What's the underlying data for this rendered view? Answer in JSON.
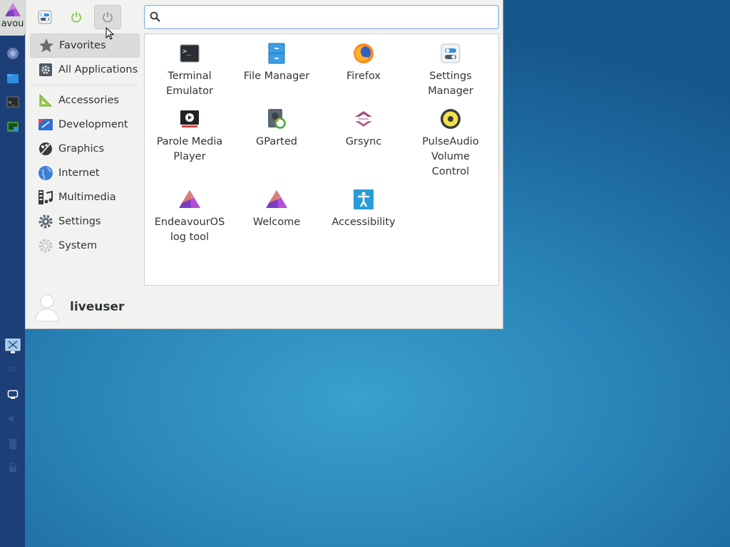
{
  "panel": {
    "menu_label": "avou",
    "launchers": [
      "web-browser-icon",
      "file-manager-icon",
      "terminal-icon",
      "screenshot-icon"
    ],
    "tray": [
      "display-icon",
      "network-icon",
      "monitor-icon",
      "volume-icon",
      "trash-icon",
      "lock-icon"
    ]
  },
  "toolbar": {
    "buttons": [
      "settings-manager-icon",
      "power-green-icon",
      "logout-icon"
    ]
  },
  "search": {
    "value": "",
    "placeholder": ""
  },
  "categories": [
    {
      "label": "Favorites",
      "icon": "star-icon",
      "selected": true
    },
    {
      "label": "All Applications",
      "icon": "gear-box-icon"
    },
    {
      "label": "Accessories",
      "icon": "set-square-icon"
    },
    {
      "label": "Development",
      "icon": "development-icon"
    },
    {
      "label": "Graphics",
      "icon": "palette-icon"
    },
    {
      "label": "Internet",
      "icon": "globe-icon"
    },
    {
      "label": "Multimedia",
      "icon": "film-music-icon"
    },
    {
      "label": "Settings",
      "icon": "gear-icon"
    },
    {
      "label": "System",
      "icon": "system-gear-icon"
    }
  ],
  "apps": [
    {
      "label": "Terminal\nEmulator",
      "icon": "terminal-icon"
    },
    {
      "label": "File Manager",
      "icon": "file-manager-icon"
    },
    {
      "label": "Firefox",
      "icon": "firefox-icon"
    },
    {
      "label": "Settings\nManager",
      "icon": "settings-manager-icon"
    },
    {
      "label": "Parole Media\nPlayer",
      "icon": "media-player-icon"
    },
    {
      "label": "GParted",
      "icon": "gparted-icon"
    },
    {
      "label": "Grsync",
      "icon": "grsync-icon"
    },
    {
      "label": "PulseAudio\nVolume\nControl",
      "icon": "speaker-icon"
    },
    {
      "label": "EndeavourOS\nlog tool",
      "icon": "endeavouros-icon"
    },
    {
      "label": "Welcome",
      "icon": "endeavouros-icon"
    },
    {
      "label": "Accessibility",
      "icon": "accessibility-icon"
    }
  ],
  "user": {
    "name": "liveuser",
    "icon": "user-avatar-icon"
  },
  "colors": {
    "panel": "#1c3f78",
    "accent_purple": "#7b3fc4",
    "search_border": "#8fb3d9"
  }
}
